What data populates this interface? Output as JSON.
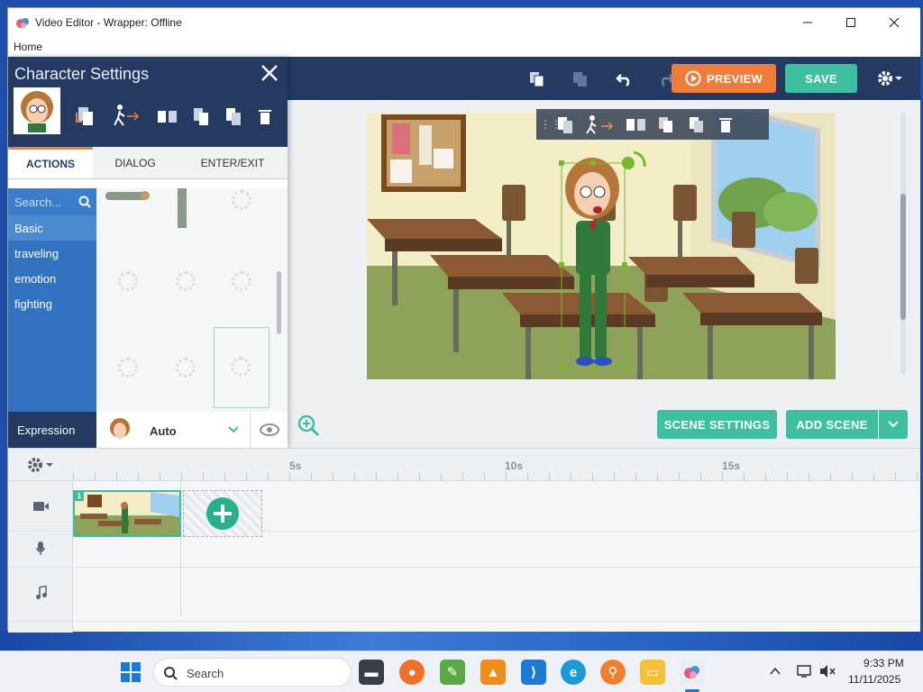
{
  "window": {
    "title": "Video Editor - Wrapper: Offline",
    "menu_home": "Home"
  },
  "toolbar": {
    "preview": "PREVIEW",
    "save": "SAVE"
  },
  "character_panel": {
    "title": "Character Settings",
    "tabs": [
      "ACTIONS",
      "DIALOG",
      "ENTER/EXIT"
    ],
    "search_placeholder": "Search...",
    "categories": [
      "Basic",
      "traveling",
      "emotion",
      "fighting"
    ],
    "expression_label": "Expression",
    "expression_value": "Auto"
  },
  "scene": {
    "scene_settings": "SCENE SETTINGS",
    "add_scene": "ADD SCENE",
    "scene_number": "1"
  },
  "timeline": {
    "ticks": [
      "5s",
      "10s",
      "15s"
    ]
  },
  "taskbar": {
    "search": "Search",
    "time": "9:33 PM",
    "date": "11/11/2025"
  },
  "colors": {
    "navy": "#253a63",
    "orange": "#f07c3a",
    "teal": "#3dbfa0",
    "blue": "#3173c0"
  }
}
